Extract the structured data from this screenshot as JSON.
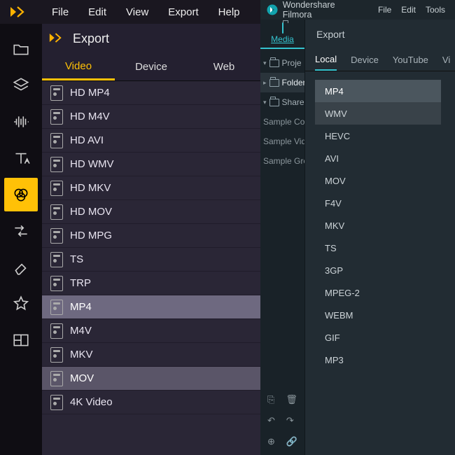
{
  "left_app": {
    "menus": [
      "File",
      "Edit",
      "View",
      "Export",
      "Help"
    ],
    "panel_title": "Export",
    "tabs": [
      {
        "label": "Video",
        "active": true
      },
      {
        "label": "Device",
        "active": false
      },
      {
        "label": "Web",
        "active": false
      }
    ],
    "sidebar_icons": [
      {
        "name": "folder-icon",
        "active": false
      },
      {
        "name": "layers-icon",
        "active": false
      },
      {
        "name": "audio-waveform-icon",
        "active": false
      },
      {
        "name": "text-icon",
        "active": false
      },
      {
        "name": "color-filter-icon",
        "active": true
      },
      {
        "name": "transitions-icon",
        "active": false
      },
      {
        "name": "eraser-icon",
        "active": false
      },
      {
        "name": "star-icon",
        "active": false
      },
      {
        "name": "split-screen-icon",
        "active": false
      }
    ],
    "formats": [
      {
        "label": "HD MP4"
      },
      {
        "label": "HD M4V"
      },
      {
        "label": "HD AVI"
      },
      {
        "label": "HD WMV"
      },
      {
        "label": "HD MKV"
      },
      {
        "label": "HD MOV"
      },
      {
        "label": "HD MPG"
      },
      {
        "label": "TS"
      },
      {
        "label": "TRP"
      },
      {
        "label": "MP4",
        "selected": "selected"
      },
      {
        "label": "M4V"
      },
      {
        "label": "MKV"
      },
      {
        "label": "MOV",
        "selected": "selected2"
      },
      {
        "label": "4K Video"
      }
    ]
  },
  "right_app": {
    "app_name": "Wondershare Filmora",
    "menus": [
      "File",
      "Edit",
      "Tools"
    ],
    "media_tab_label": "Media",
    "tree": [
      {
        "type": "folder",
        "label": "Proje",
        "expanded": true
      },
      {
        "type": "folder",
        "label": "Folder",
        "selected": true,
        "expanded": false
      },
      {
        "type": "folder",
        "label": "Share",
        "expanded": true
      },
      {
        "type": "sample",
        "label": "Sample Colo"
      },
      {
        "type": "sample",
        "label": "Sample Vide"
      },
      {
        "type": "sample",
        "label": "Sample Gre"
      }
    ],
    "bottom_icons": [
      [
        "new-folder-icon",
        "delete-icon"
      ],
      [
        "undo-icon",
        "redo-icon"
      ],
      [
        "add-media-icon",
        "link-icon"
      ]
    ],
    "export": {
      "title": "Export",
      "tabs": [
        {
          "label": "Local",
          "active": true
        },
        {
          "label": "Device",
          "active": false
        },
        {
          "label": "YouTube",
          "active": false
        },
        {
          "label": "Vi",
          "active": false
        }
      ],
      "formats": [
        {
          "label": "MP4",
          "sel": "sel1"
        },
        {
          "label": "WMV",
          "sel": "sel2"
        },
        {
          "label": "HEVC"
        },
        {
          "label": "AVI"
        },
        {
          "label": "MOV"
        },
        {
          "label": "F4V"
        },
        {
          "label": "MKV"
        },
        {
          "label": "TS"
        },
        {
          "label": "3GP"
        },
        {
          "label": "MPEG-2"
        },
        {
          "label": "WEBM"
        },
        {
          "label": "GIF"
        },
        {
          "label": "MP3"
        }
      ]
    }
  }
}
